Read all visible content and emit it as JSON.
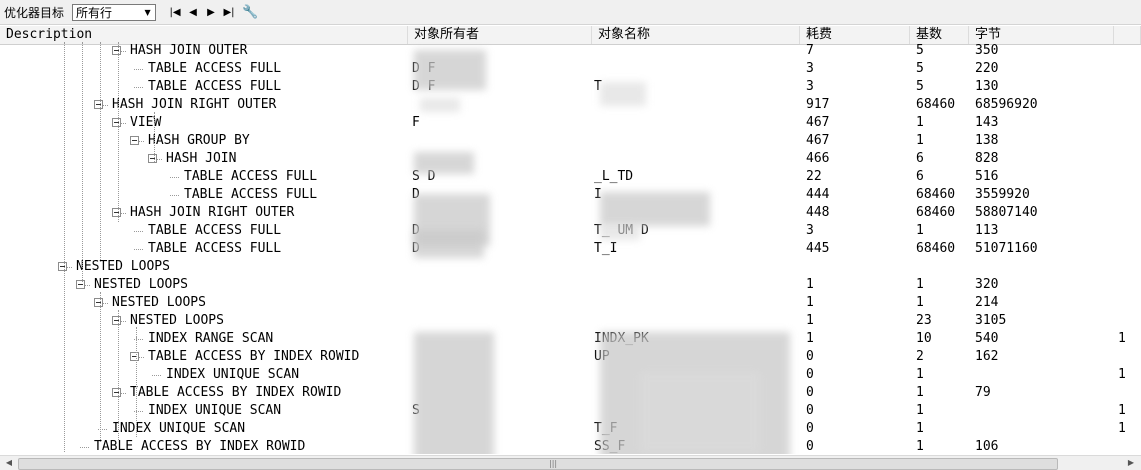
{
  "toolbar": {
    "label": "优化器目标",
    "select_value": "所有行",
    "nav_icons": [
      "first-icon",
      "prev-icon",
      "next-icon",
      "last-icon"
    ],
    "wrench_icon": "wrench-icon"
  },
  "columns": {
    "description": "Description",
    "owner": "对象所有者",
    "name": "对象名称",
    "cost": "耗费",
    "cardinality": "基数",
    "bytes": "字节"
  },
  "rows": [
    {
      "op": "HASH JOIN OUTER",
      "depth": 3,
      "toggle": true,
      "owner": "",
      "name": "",
      "cost": "7",
      "card": "5",
      "bytes": "350",
      "extra": ""
    },
    {
      "op": "TABLE ACCESS FULL",
      "depth": 4,
      "toggle": false,
      "owner": "D  F",
      "name": "",
      "cost": "3",
      "card": "5",
      "bytes": "220",
      "extra": ""
    },
    {
      "op": "TABLE ACCESS FULL",
      "depth": 4,
      "toggle": false,
      "owner": "D  F",
      "name": "T",
      "cost": "3",
      "card": "5",
      "bytes": "130",
      "extra": ""
    },
    {
      "op": "HASH JOIN RIGHT OUTER",
      "depth": 2,
      "toggle": true,
      "owner": "",
      "name": "",
      "cost": "917",
      "card": "68460",
      "bytes": "68596920",
      "extra": ""
    },
    {
      "op": "VIEW",
      "depth": 3,
      "toggle": true,
      "owner": "F",
      "name": "",
      "cost": "467",
      "card": "1",
      "bytes": "143",
      "extra": ""
    },
    {
      "op": "HASH GROUP BY",
      "depth": 4,
      "toggle": true,
      "owner": "",
      "name": "",
      "cost": "467",
      "card": "1",
      "bytes": "138",
      "extra": ""
    },
    {
      "op": "HASH JOIN",
      "depth": 5,
      "toggle": true,
      "owner": "",
      "name": "",
      "cost": "466",
      "card": "6",
      "bytes": "828",
      "extra": ""
    },
    {
      "op": "TABLE ACCESS FULL",
      "depth": 6,
      "toggle": false,
      "owner": "S  D",
      "name": "_L_TD",
      "cost": "22",
      "card": "6",
      "bytes": "516",
      "extra": ""
    },
    {
      "op": "TABLE ACCESS FULL",
      "depth": 6,
      "toggle": false,
      "owner": "D",
      "name": "I",
      "cost": "444",
      "card": "68460",
      "bytes": "3559920",
      "extra": ""
    },
    {
      "op": "HASH JOIN RIGHT OUTER",
      "depth": 3,
      "toggle": true,
      "owner": "",
      "name": "",
      "cost": "448",
      "card": "68460",
      "bytes": "58807140",
      "extra": ""
    },
    {
      "op": "TABLE ACCESS FULL",
      "depth": 4,
      "toggle": false,
      "owner": "D",
      "name": "T_  UM  D",
      "cost": "3",
      "card": "1",
      "bytes": "113",
      "extra": ""
    },
    {
      "op": "TABLE ACCESS FULL",
      "depth": 4,
      "toggle": false,
      "owner": "D",
      "name": "T_I",
      "cost": "445",
      "card": "68460",
      "bytes": "51071160",
      "extra": ""
    },
    {
      "op": "NESTED LOOPS",
      "depth": 0,
      "toggle": true,
      "owner": "",
      "name": "",
      "cost": "",
      "card": "",
      "bytes": "",
      "extra": ""
    },
    {
      "op": "NESTED LOOPS",
      "depth": 1,
      "toggle": true,
      "owner": "",
      "name": "",
      "cost": "1",
      "card": "1",
      "bytes": "320",
      "extra": ""
    },
    {
      "op": "NESTED LOOPS",
      "depth": 2,
      "toggle": true,
      "owner": "",
      "name": "",
      "cost": "1",
      "card": "1",
      "bytes": "214",
      "extra": ""
    },
    {
      "op": "NESTED LOOPS",
      "depth": 3,
      "toggle": true,
      "owner": "",
      "name": "",
      "cost": "1",
      "card": "23",
      "bytes": "3105",
      "extra": ""
    },
    {
      "op": "INDEX RANGE SCAN",
      "depth": 4,
      "toggle": false,
      "owner": "",
      "name": "INDX_PK",
      "cost": "1",
      "card": "10",
      "bytes": "540",
      "extra": "1"
    },
    {
      "op": "TABLE ACCESS BY INDEX ROWID",
      "depth": 4,
      "toggle": true,
      "owner": "",
      "name": "UP",
      "cost": "0",
      "card": "2",
      "bytes": "162",
      "extra": ""
    },
    {
      "op": "INDEX UNIQUE SCAN",
      "depth": 5,
      "toggle": false,
      "owner": "",
      "name": "",
      "cost": "0",
      "card": "1",
      "bytes": "",
      "extra": "1"
    },
    {
      "op": "TABLE ACCESS BY INDEX ROWID",
      "depth": 3,
      "toggle": true,
      "owner": "",
      "name": "",
      "cost": "0",
      "card": "1",
      "bytes": "79",
      "extra": ""
    },
    {
      "op": "INDEX UNIQUE SCAN",
      "depth": 4,
      "toggle": false,
      "owner": "S",
      "name": "",
      "cost": "0",
      "card": "1",
      "bytes": "",
      "extra": "1"
    },
    {
      "op": "INDEX UNIQUE SCAN",
      "depth": 2,
      "toggle": false,
      "owner": "",
      "name": "T_F",
      "cost": "0",
      "card": "1",
      "bytes": "",
      "extra": "1"
    },
    {
      "op": "TABLE ACCESS BY INDEX ROWID",
      "depth": 1,
      "toggle": false,
      "owner": "",
      "name": "SS_F",
      "cost": "0",
      "card": "1",
      "bytes": "106",
      "extra": ""
    }
  ],
  "scrollbar": {
    "grip": "|||"
  }
}
